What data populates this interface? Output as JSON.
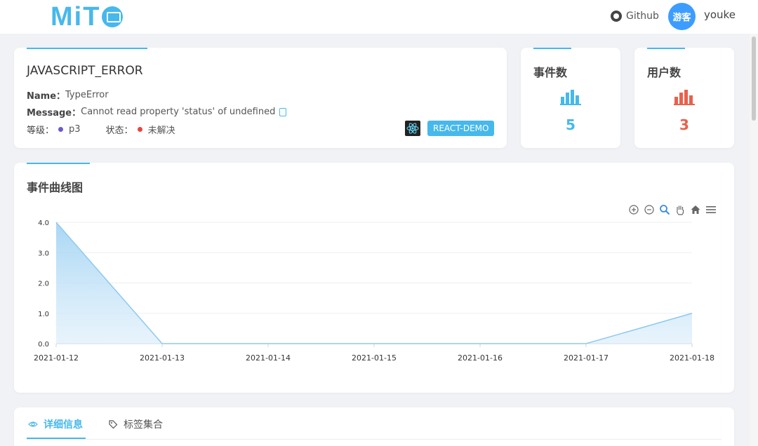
{
  "header": {
    "logo_text": "MiT",
    "github_label": "Github",
    "avatar_text": "游客",
    "username": "youke"
  },
  "error_card": {
    "title": "JAVASCRIPT_ERROR",
    "name_key": "Name：",
    "name_value": "TypeError",
    "message_key": "Message：",
    "message_value": "Cannot read property 'status' of undefined",
    "level_key": "等级：",
    "level_value": "p3",
    "level_color": "#6a5acd",
    "status_key": "状态：",
    "status_value": "未解决",
    "status_color": "#e8453c",
    "project_tag": "REACT-DEMO"
  },
  "stats": {
    "events": {
      "label": "事件数",
      "value": "5",
      "color": "#47b8ec",
      "icon": "bar-chart-icon"
    },
    "users": {
      "label": "用户数",
      "value": "3",
      "color": "#e8614e",
      "icon": "bar-chart-icon"
    }
  },
  "chart_card": {
    "title": "事件曲线图"
  },
  "chart_data": {
    "type": "area",
    "x": [
      "2021-01-12",
      "2021-01-13",
      "2021-01-14",
      "2021-01-15",
      "2021-01-16",
      "2021-01-17",
      "2021-01-18"
    ],
    "series": [
      {
        "values": [
          4,
          0,
          0,
          0,
          0,
          0,
          1
        ]
      }
    ],
    "yticks": [
      "0.0",
      "1.0",
      "2.0",
      "3.0",
      "4.0"
    ],
    "ylim": [
      0,
      4
    ],
    "grid": true,
    "color": "#8ec9ee"
  },
  "tabs": [
    {
      "label": "详细信息",
      "icon": "eye-icon",
      "active": true
    },
    {
      "label": "标签集合",
      "icon": "tag-icon",
      "active": false
    }
  ],
  "colors": {
    "accent": "#47b8ec",
    "page_bg": "#f0f2f5"
  }
}
